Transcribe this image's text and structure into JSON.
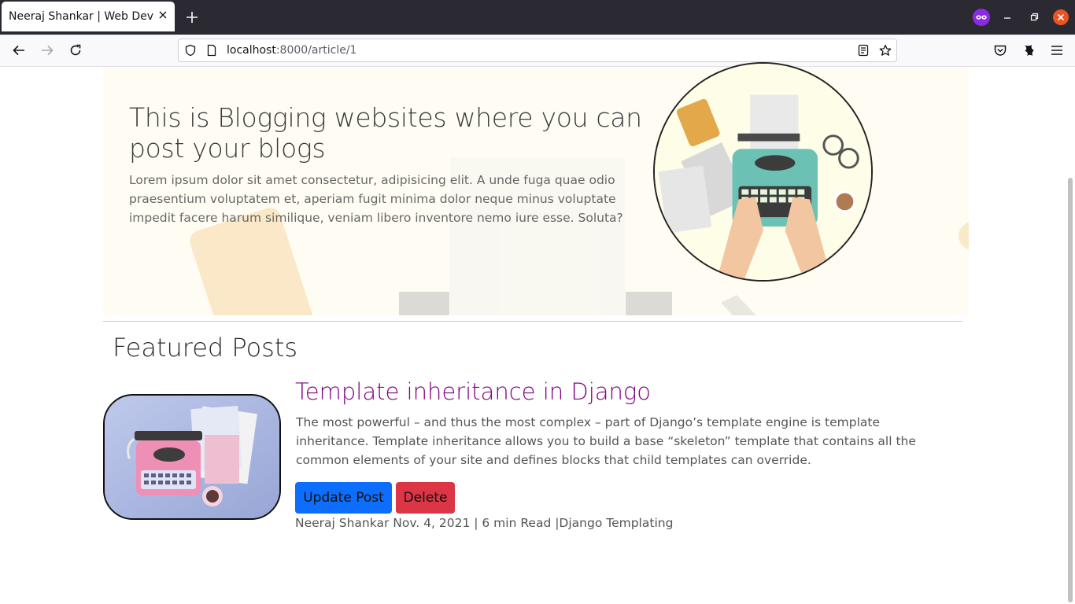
{
  "browser": {
    "tab_title": "Neeraj Shankar | Web Developer",
    "url_host": "localhost",
    "url_path": ":8000/article/1"
  },
  "hero": {
    "title": "This is Blogging websites where you can post your blogs",
    "text": "Lorem ipsum dolor sit amet consectetur, adipisicing elit. A unde fuga quae odio praesentium voluptatem et, aperiam fugit minima dolor neque minus voluptate impedit facere harum similique, veniam libero inventore nemo iure esse. Soluta?"
  },
  "featured": {
    "heading": "Featured Posts"
  },
  "post": {
    "title": "Template inheritance in Django",
    "excerpt": "The most powerful – and thus the most complex – part of Django’s template engine is template inheritance. Template inheritance allows you to build a base “skeleton” template that contains all the common elements of your site and defines blocks that child templates can override.",
    "update_label": "Update Post",
    "delete_label": "Delete",
    "meta": "Neeraj Shankar Nov. 4, 2021 | 6 min Read |Django Templating"
  },
  "colors": {
    "link_purple": "#800080",
    "primary_button": "#0d6efd",
    "danger_button": "#dc3545"
  }
}
